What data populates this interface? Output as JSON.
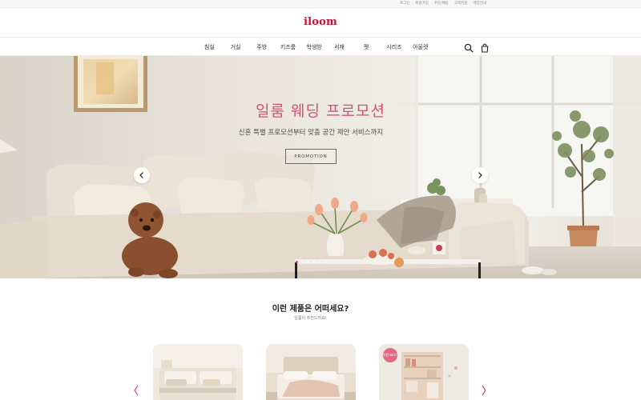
{
  "util_links": [
    "로그인",
    "회원가입",
    "주문/배송",
    "고객지원",
    "매장안내"
  ],
  "brand": {
    "logo_text": "iloom",
    "color": "#c8102e"
  },
  "nav": {
    "items": [
      "침실",
      "거실",
      "주방",
      "키즈룸",
      "학생방",
      "서재",
      "펫",
      "시리즈",
      "아울렛"
    ],
    "icons": [
      "search-icon",
      "shopping-bag-icon"
    ]
  },
  "hero": {
    "title": "일룸 웨딩 프로모션",
    "subtitle": "신혼 특별 프로모션부터 맞춤 공간 제안 서비스까지",
    "button_label": "PROMOTION",
    "title_color": "#d0546a",
    "slide_count": 6,
    "active_slide": 1,
    "icons": [
      "chevron-left-icon",
      "chevron-right-icon"
    ]
  },
  "recommend": {
    "title": "이런 제품은 어떠세요?",
    "subtitle": "일룸이 추천드려요!",
    "products": [
      {
        "badge": ""
      },
      {
        "badge": ""
      },
      {
        "badge": "추천 BEST"
      }
    ]
  }
}
